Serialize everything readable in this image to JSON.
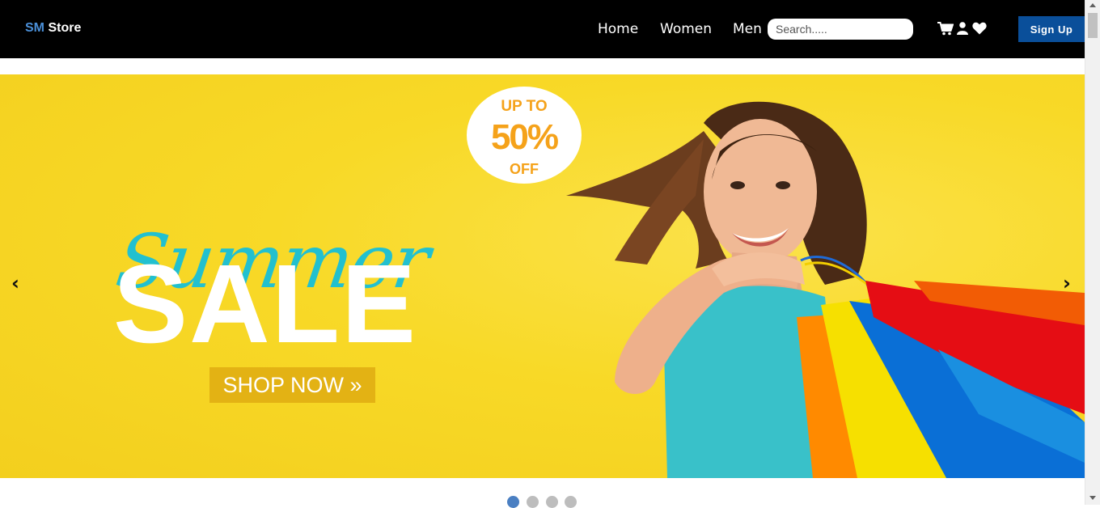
{
  "navbar": {
    "brand_prefix": "SM",
    "brand_suffix": "Store",
    "links": [
      "Home",
      "Women",
      "Men"
    ],
    "search_placeholder": "Search.....",
    "icons": [
      "cart-icon",
      "user-icon",
      "heart-icon"
    ],
    "signup_label": "Sign Up",
    "colors": {
      "background": "#000000",
      "brand_accent": "#4a8fd8",
      "signup_bg": "#0a4f9a"
    }
  },
  "carousel": {
    "badge": {
      "line1": "UP TO",
      "line2": "50%",
      "line3": "OFF"
    },
    "script_title": "Summer",
    "main_title": "SALE",
    "cta_label": "SHOP NOW »",
    "prev_label": "‹",
    "next_label": "›",
    "slide_count": 4,
    "active_slide": 1,
    "colors": {
      "background": "#f8d927",
      "script": "#22c0cf",
      "badge_text": "#f5a21a",
      "cta_bg": "#e3b214"
    }
  }
}
